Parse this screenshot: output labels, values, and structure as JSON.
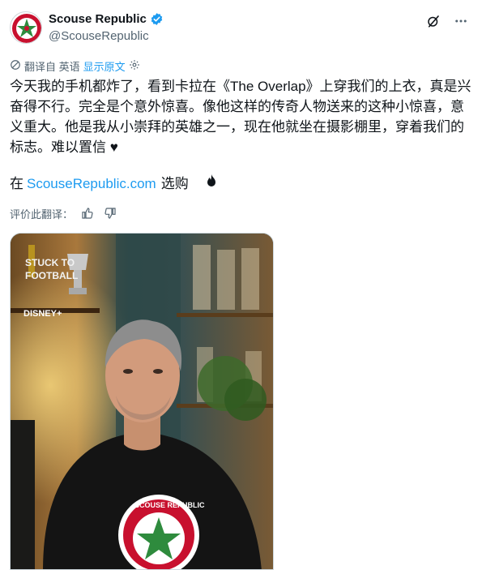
{
  "author": {
    "display_name": "Scouse Republic",
    "handle": "@ScouseRepublic"
  },
  "translation": {
    "translated_from": "翻译自 英语",
    "show_original": "显示原文"
  },
  "tweet": {
    "text": "今天我的手机都炸了，看到卡拉在《The Overlap》上穿我们的上衣，真是兴奋得不行。完全是个意外惊喜。像他这样的传奇人物送来的这种小惊喜，意义重大。他是我从小崇拜的英雄之一，现在他就坐在摄影棚里，穿着我们的标志。难以置信 ♥",
    "shop_prefix": "在",
    "shop_link": "ScouseRepublic.com",
    "shop_suffix": "选购"
  },
  "rating": {
    "label": "评价此翻译："
  },
  "media": {
    "shirt_text": "SCOUSE REPUBLIC",
    "shelf_text": "STUCK TO FOOTBALL",
    "brand_logo": "DISNEY+"
  },
  "colors": {
    "link": "#1d9bf0",
    "secondary_text": "#536471",
    "verified_badge": "#1d9bf0"
  },
  "icons": [
    "verified-badge-icon",
    "grok-icon",
    "more-icon",
    "translate-icon",
    "settings-icon",
    "fire-icon",
    "thumbs-up-icon",
    "thumbs-down-icon"
  ]
}
